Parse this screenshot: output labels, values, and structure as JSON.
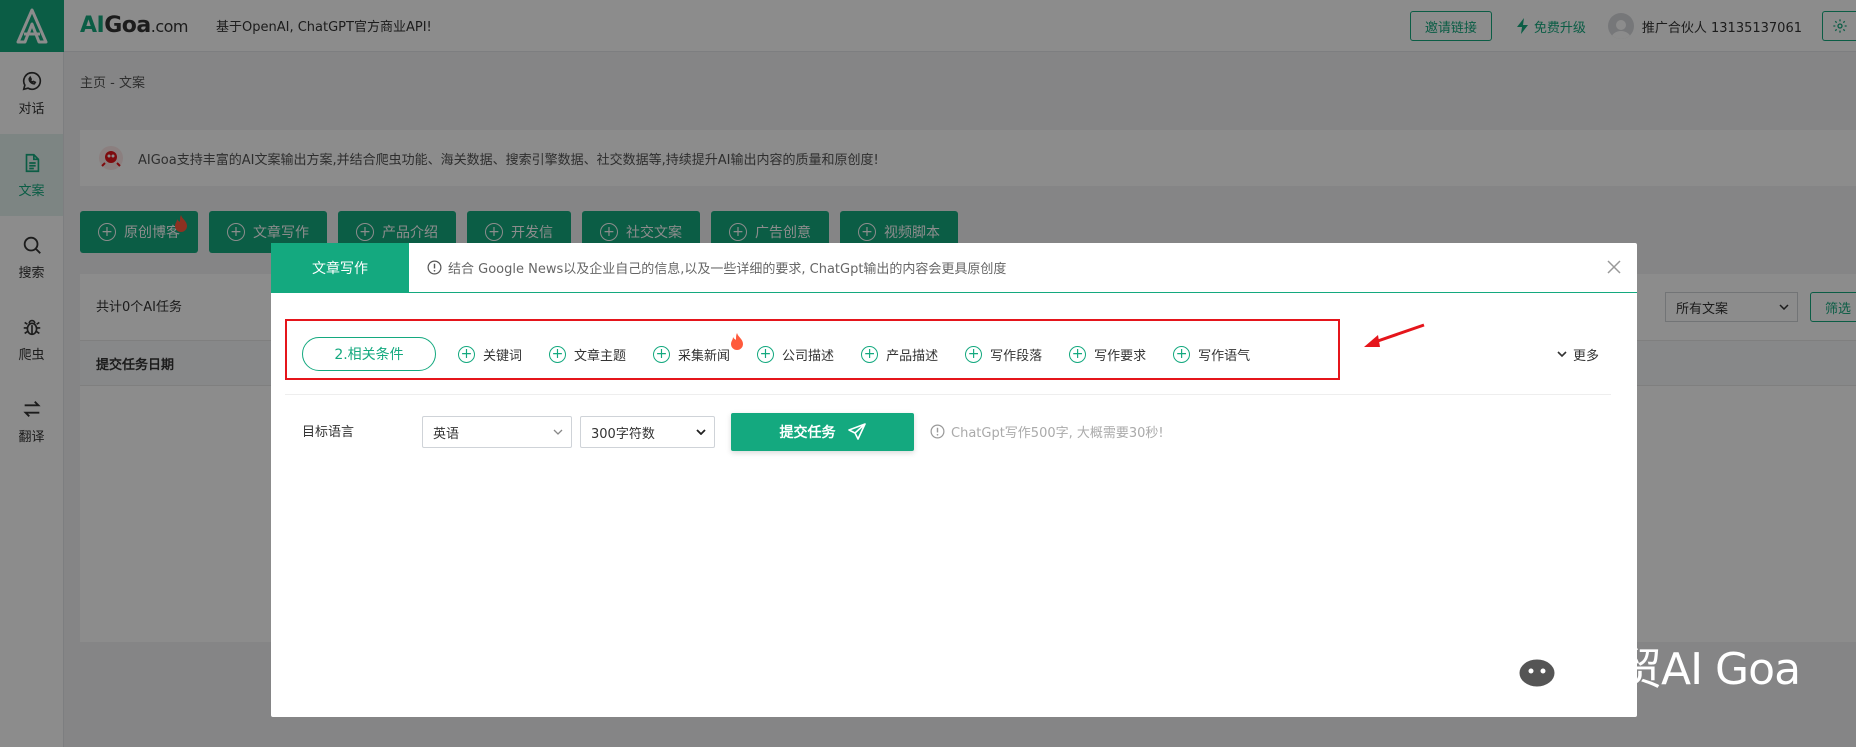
{
  "sidebar": {
    "items": [
      {
        "label": "对话",
        "icon": "chat-icon"
      },
      {
        "label": "文案",
        "icon": "document-icon"
      },
      {
        "label": "搜索",
        "icon": "search-icon"
      },
      {
        "label": "爬虫",
        "icon": "bug-icon"
      },
      {
        "label": "翻译",
        "icon": "swap-icon"
      }
    ]
  },
  "topbar": {
    "brand_ai": "AI",
    "brand_goa": "Goa",
    "brand_com": ".com",
    "tagline": "基于OpenAI, ChatGPT官方商业API!",
    "invite_label": "邀请链接",
    "upgrade_label": "免费升级",
    "user_label": "推广合伙人 13135137061"
  },
  "breadcrumb": "主页 - 文案",
  "info_bar": "AIGoa支持丰富的AI文案输出方案,并结合爬虫功能、海关数据、搜索引擎数据、社交数据等,持续提升AI输出内容的质量和原创度!",
  "categories": [
    "原创博客",
    "文章写作",
    "产品介绍",
    "开发信",
    "社交文案",
    "广告创意",
    "视频脚本"
  ],
  "task_panel": {
    "count_text": "共计0个AI任务",
    "column_date": "提交任务日期",
    "filter_select": "所有文案",
    "filter_button": "筛选"
  },
  "modal": {
    "tab_label": "文章写作",
    "tip": "结合 Google News以及企业自己的信息,以及一些详细的要求, ChatGpt输出的内容会更具原创度",
    "conditions_pill": "2.相关条件",
    "options": [
      "关键词",
      "文章主题",
      "采集新闻",
      "公司描述",
      "产品描述",
      "写作段落",
      "写作要求",
      "写作语气"
    ],
    "more_label": "更多",
    "lang_label": "目标语言",
    "lang_value": "英语",
    "words_value": "300字符数",
    "submit_label": "提交任务",
    "hint": "ChatGpt写作500字, 大概需要30秒!"
  },
  "watermark": "创贸AI Goa",
  "colors": {
    "accent": "#14a97f",
    "highlight": "#e5151b"
  }
}
